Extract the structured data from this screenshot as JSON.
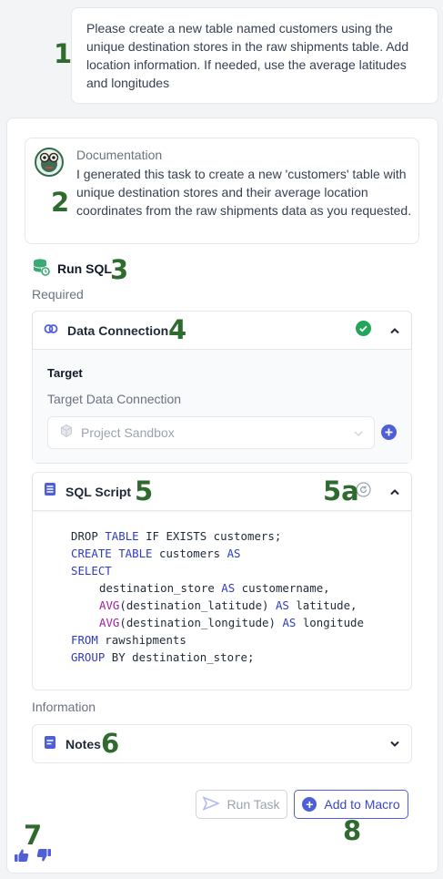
{
  "markers": {
    "m1": "1",
    "m2": "2",
    "m3": "3",
    "m4": "4",
    "m5": "5",
    "m5a": "5a",
    "m6": "6",
    "m7": "7",
    "m8": "8"
  },
  "user_message": "Please create a new table named customers using the unique destination stores in the raw shipments table. Add location information. If needed, use the average latitudes and longitudes",
  "documentation": {
    "title": "Documentation",
    "text": "I generated this task to create a new 'customers' table with unique destination stores and their average location coordinates from the raw shipments data as you requested."
  },
  "task": {
    "name": "Run SQL",
    "required_label": "Required",
    "information_label": "Information"
  },
  "data_connection": {
    "title": "Data Connection",
    "status": "connected",
    "target_title": "Target",
    "target_sublabel": "Target Data Connection",
    "selected_value": "Project Sandbox"
  },
  "sql_script": {
    "title": "SQL Script",
    "lines": [
      {
        "k1": "DROP ",
        "k2": "TABLE",
        "t": " IF EXISTS customers;"
      },
      {
        "k1": "",
        "k2": "CREATE TABLE",
        "t": " customers ",
        "k3": "AS"
      },
      {
        "k2": "SELECT"
      },
      {
        "t": "destination_store ",
        "k3": "AS",
        "t2": " customername,"
      },
      {
        "f": "AVG",
        "t": "(destination_latitude) ",
        "k3": "AS",
        "t2": " latitude,"
      },
      {
        "f": "AVG",
        "t": "(destination_longitude) ",
        "k3": "AS",
        "t2": " longitude"
      },
      {
        "k2": "FROM",
        "t": " rawshipments"
      },
      {
        "k2": "GROUP",
        "t": " BY destination_store;"
      }
    ]
  },
  "notes": {
    "title": "Notes"
  },
  "buttons": {
    "run_task": "Run Task",
    "add_to_macro": "Add to Macro"
  },
  "colors": {
    "accent": "#4f5fd6",
    "success": "#22a55a",
    "marker": "#2f6b2f"
  },
  "icons": [
    "robot-avatar-icon",
    "database-refresh-icon",
    "linked-rings-icon",
    "check-circle-icon",
    "chevron-up-icon",
    "chevron-down-icon",
    "cube-icon",
    "plus-circle-icon",
    "document-lines-icon",
    "refresh-circle-icon",
    "notes-icon",
    "send-icon",
    "thumbs-up-icon",
    "thumbs-down-icon"
  ]
}
